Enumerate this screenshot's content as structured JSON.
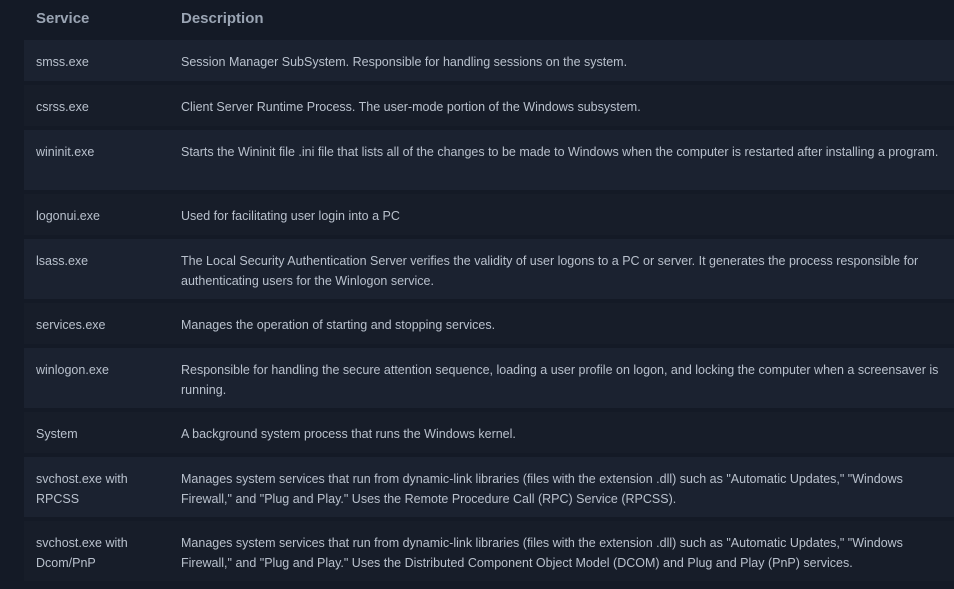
{
  "table": {
    "headers": [
      "Service",
      "Description"
    ],
    "rows": [
      {
        "service": "smss.exe",
        "description": "Session Manager SubSystem. Responsible for handling sessions on the system."
      },
      {
        "service": "csrss.exe",
        "description": "Client Server Runtime Process. The user-mode portion of the Windows subsystem."
      },
      {
        "service": "wininit.exe",
        "description": "Starts the Wininit file .ini file that lists all of the changes to be made to Windows when the computer is restarted after installing a program."
      },
      {
        "service": "logonui.exe",
        "description": "Used for facilitating user login into a PC"
      },
      {
        "service": "lsass.exe",
        "description": "The Local Security Authentication Server verifies the validity of user logons to a PC or server. It generates the process responsible for authenticating users for the Winlogon service."
      },
      {
        "service": "services.exe",
        "description": "Manages the operation of starting and stopping services."
      },
      {
        "service": "winlogon.exe",
        "description": "Responsible for handling the secure attention sequence, loading a user profile on logon, and locking the computer when a screensaver is running."
      },
      {
        "service": "System",
        "description": "A background system process that runs the Windows kernel."
      },
      {
        "service": "svchost.exe with RPCSS",
        "description": "Manages system services that run from dynamic-link libraries (files with the extension .dll) such as \"Automatic Updates,\" \"Windows Firewall,\" and \"Plug and Play.\" Uses the Remote Procedure Call (RPC) Service (RPCSS)."
      },
      {
        "service": "svchost.exe with Dcom/PnP",
        "description": "Manages system services that run from dynamic-link libraries (files with the extension .dll) such as \"Automatic Updates,\" \"Windows Firewall,\" and \"Plug and Play.\" Uses the Distributed Component Object Model (DCOM) and Plug and Play (PnP) services."
      }
    ]
  }
}
